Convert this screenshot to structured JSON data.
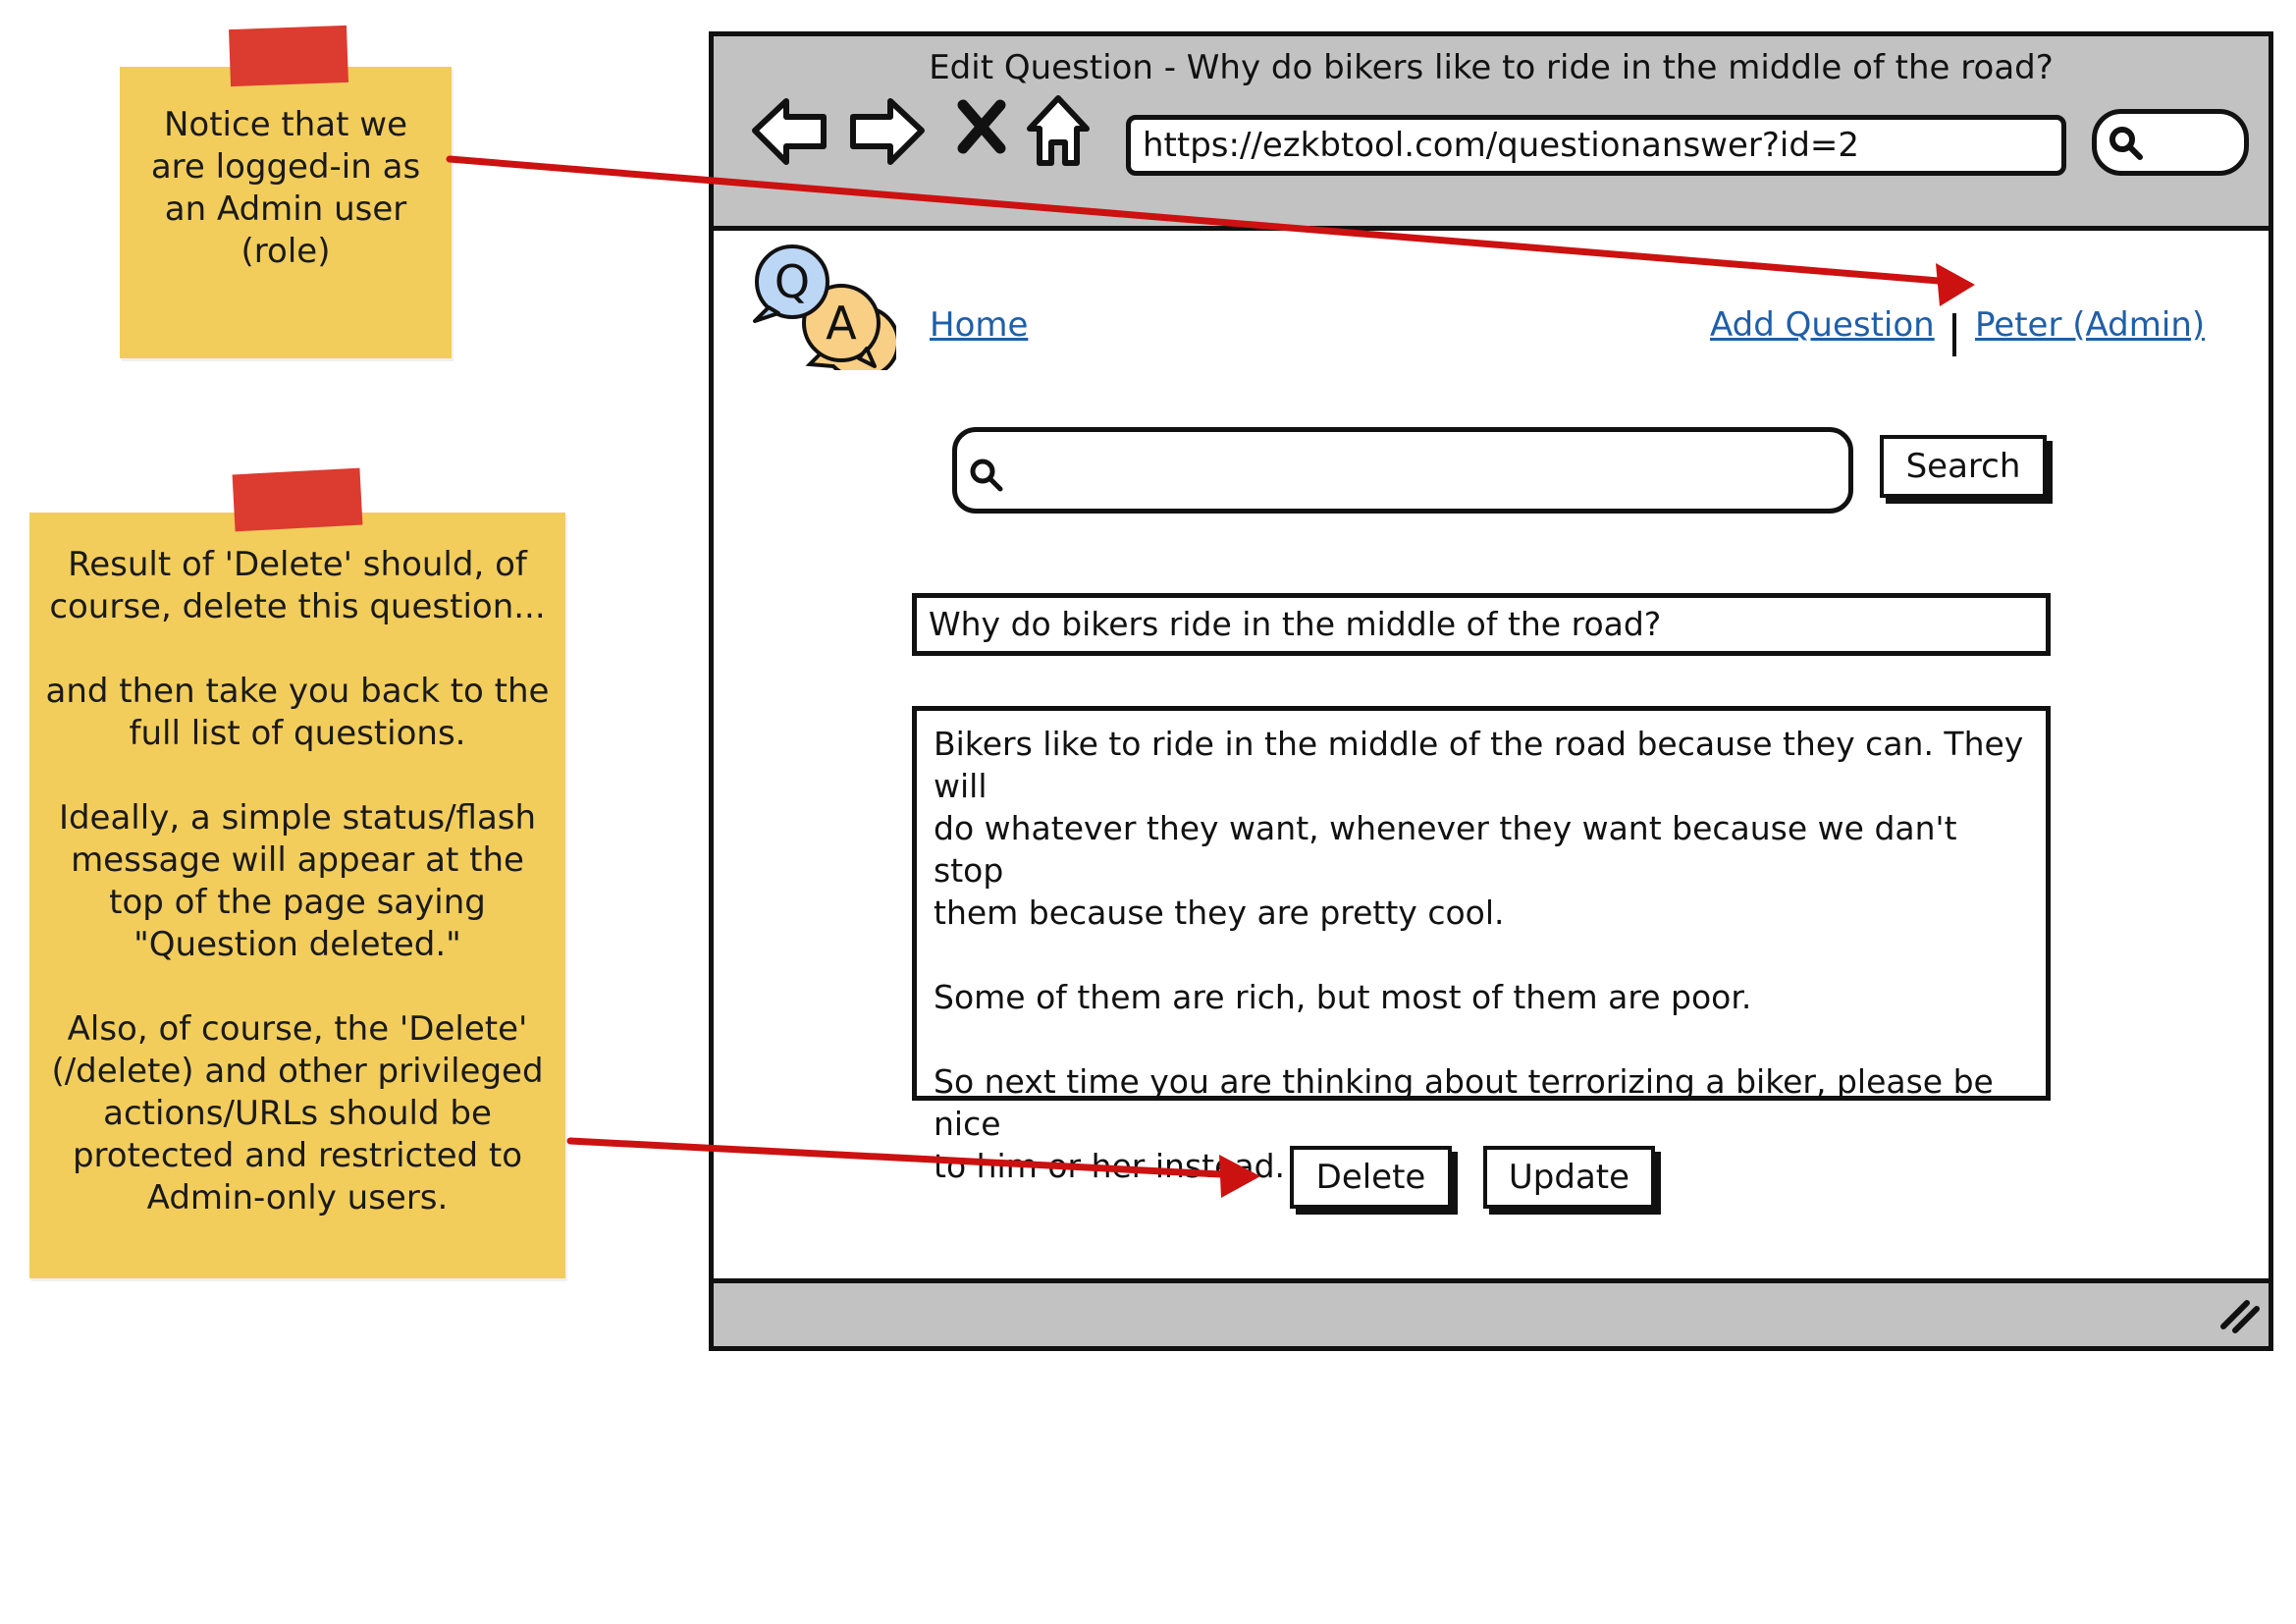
{
  "notes": {
    "login_note": [
      "Notice that we",
      "are logged-in as",
      "an Admin user",
      "(role)"
    ],
    "delete_note": [
      [
        "Result of 'Delete' should, of",
        "course, delete this question..."
      ],
      [
        "and then take you back to the",
        "full list of questions."
      ],
      [
        "Ideally, a simple status/flash",
        "message will appear at the",
        "top of the page saying",
        "\"Question deleted.\""
      ],
      [
        "Also, of course, the 'Delete'",
        "(/delete) and other privileged",
        "actions/URLs should be",
        "protected and restricted to",
        "Admin-only users."
      ]
    ]
  },
  "browser": {
    "title": "Edit Question - Why do bikers like to ride in the middle of the road?",
    "url": "https://ezkbtool.com/questionanswer?id=2"
  },
  "nav": {
    "home": "Home",
    "add_question": "Add Question",
    "user": "Peter (Admin)"
  },
  "search": {
    "value": "",
    "button_label": "Search"
  },
  "question": {
    "title": "Why do bikers ride in the middle of the road?",
    "answer_paragraphs": [
      [
        "Bikers like to ride in the middle of the road because they can. They will",
        "do whatever they want, whenever they want because we dan't stop",
        "them because they are pretty cool."
      ],
      [
        "Some of them are rich, but most of them are poor."
      ],
      [
        "So next time you are thinking about terrorizing a biker, please be nice",
        "to him or her instead."
      ]
    ]
  },
  "actions": {
    "delete_label": "Delete",
    "update_label": "Update"
  },
  "colors": {
    "note": "#f2cd5c",
    "tape": "#dc3b30",
    "arrow": "#cc1111",
    "link": "#1f5fa8",
    "chrome": "#c2c2c2"
  }
}
